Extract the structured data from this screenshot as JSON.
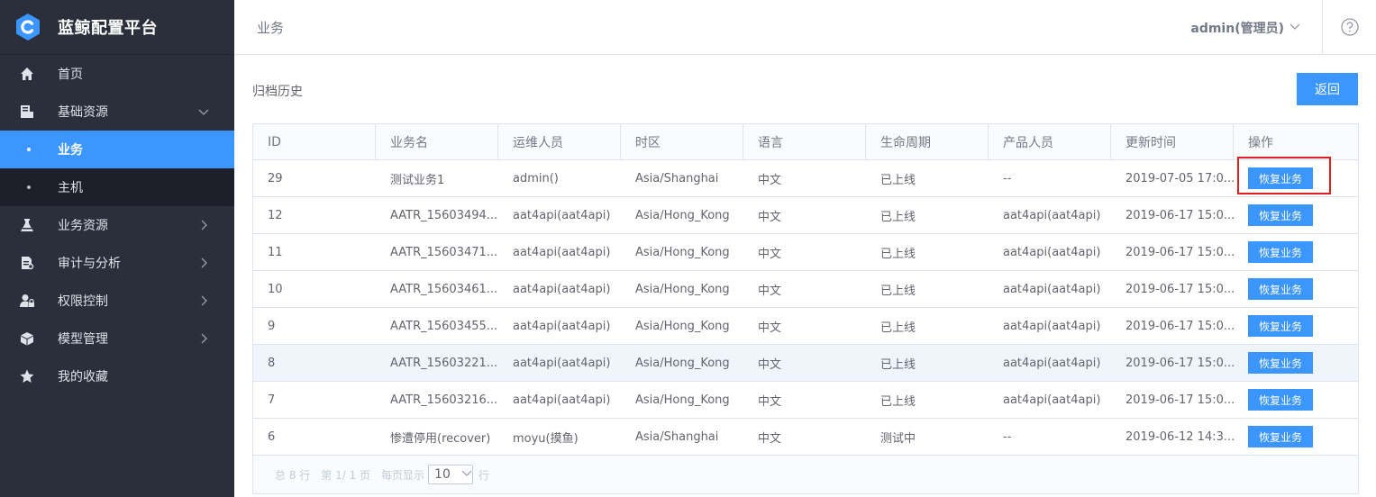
{
  "app": {
    "title": "蓝鲸配置平台"
  },
  "sidebar": {
    "items": [
      {
        "label": "首页",
        "icon": "home-icon"
      },
      {
        "label": "基础资源",
        "icon": "server-icon",
        "expanded": true,
        "children": [
          {
            "label": "业务",
            "active": true
          },
          {
            "label": "主机",
            "active": false
          }
        ]
      },
      {
        "label": "业务资源",
        "icon": "flask-icon"
      },
      {
        "label": "审计与分析",
        "icon": "audit-icon"
      },
      {
        "label": "权限控制",
        "icon": "user-lock-icon"
      },
      {
        "label": "模型管理",
        "icon": "cube-icon"
      },
      {
        "label": "我的收藏",
        "icon": "star-icon"
      }
    ]
  },
  "header": {
    "title": "业务",
    "user": "admin(管理员)",
    "help_icon": "help-icon"
  },
  "main": {
    "section_title": "归档历史",
    "back_label": "返回",
    "table": {
      "columns": [
        "ID",
        "业务名",
        "运维人员",
        "时区",
        "语言",
        "生命周期",
        "产品人员",
        "更新时间",
        "操作"
      ],
      "action_label": "恢复业务",
      "rows": [
        [
          "29",
          "测试业务1",
          "admin()",
          "Asia/Shanghai",
          "中文",
          "已上线",
          "--",
          "2019-07-05 17:0..."
        ],
        [
          "12",
          "AATR_15603494...",
          "aat4api(aat4api)",
          "Asia/Hong_Kong",
          "中文",
          "已上线",
          "aat4api(aat4api)",
          "2019-06-17 15:0..."
        ],
        [
          "11",
          "AATR_15603471...",
          "aat4api(aat4api)",
          "Asia/Hong_Kong",
          "中文",
          "已上线",
          "aat4api(aat4api)",
          "2019-06-17 15:0..."
        ],
        [
          "10",
          "AATR_15603461...",
          "aat4api(aat4api)",
          "Asia/Hong_Kong",
          "中文",
          "已上线",
          "aat4api(aat4api)",
          "2019-06-17 15:0..."
        ],
        [
          "9",
          "AATR_15603455...",
          "aat4api(aat4api)",
          "Asia/Hong_Kong",
          "中文",
          "已上线",
          "aat4api(aat4api)",
          "2019-06-17 15:0..."
        ],
        [
          "8",
          "AATR_15603221...",
          "aat4api(aat4api)",
          "Asia/Hong_Kong",
          "中文",
          "已上线",
          "aat4api(aat4api)",
          "2019-06-17 15:0..."
        ],
        [
          "7",
          "AATR_15603216...",
          "aat4api(aat4api)",
          "Asia/Hong_Kong",
          "中文",
          "已上线",
          "aat4api(aat4api)",
          "2019-06-17 15:0..."
        ],
        [
          "6",
          "惨遭停用(recover)",
          "moyu(摸鱼)",
          "Asia/Shanghai",
          "中文",
          "测试中",
          "--",
          "2019-06-12 14:3..."
        ]
      ]
    },
    "pager": {
      "total": "总 8 行",
      "page": "第 1/ 1 页",
      "per_page_label": "每页显示",
      "page_size": "10",
      "unit": "行"
    }
  },
  "colors": {
    "sidebar_bg": "#2a2f3b",
    "accent": "#3c96ff",
    "highlight": "#e02020"
  }
}
